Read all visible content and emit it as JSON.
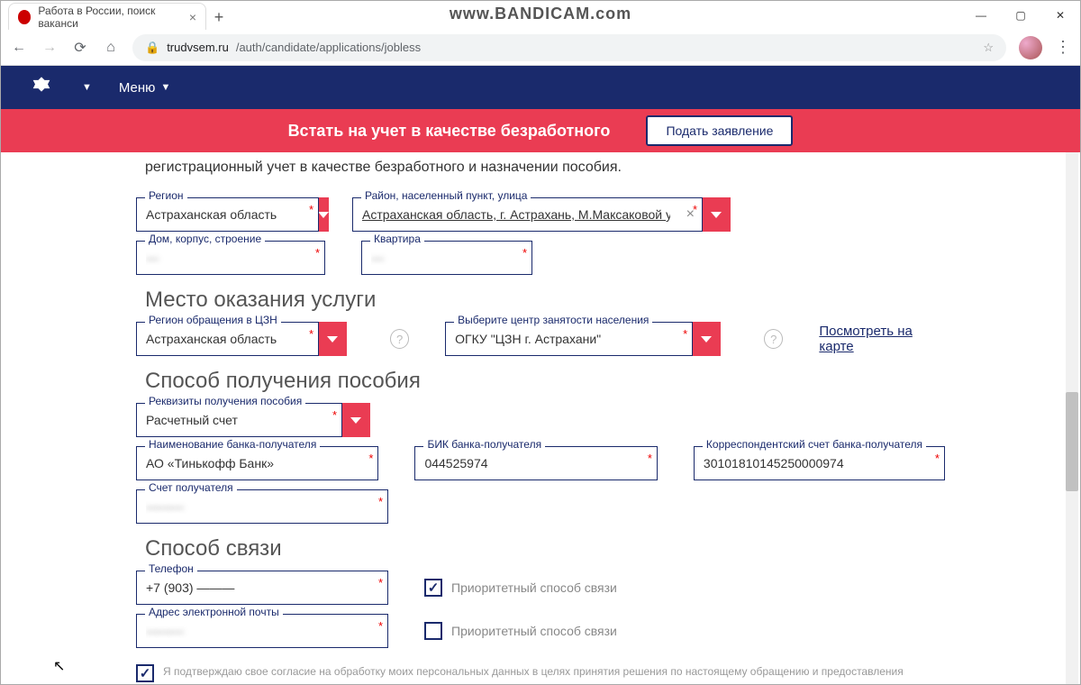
{
  "window": {
    "tab_title": "Работа в России, поиск ваканси",
    "watermark": "www.BANDICAM.com"
  },
  "browser": {
    "url_domain": "trudvsem.ru",
    "url_path": "/auth/candidate/applications/jobless"
  },
  "site_nav": {
    "menu": "Меню"
  },
  "banner": {
    "title": "Встать на учет в качестве безработного",
    "button": "Подать заявление"
  },
  "intro": "регистрационный учет в качестве безработного и назначении пособия.",
  "region": {
    "label": "Регион",
    "value": "Астраханская область"
  },
  "street": {
    "label": "Район, населенный пункт, улица",
    "value": "Астраханская область, г. Астрахань, М.Максаковой у..."
  },
  "house": {
    "label": "Дом, корпус, строение",
    "value": "—"
  },
  "flat": {
    "label": "Квартира",
    "value": "—"
  },
  "section_service": "Место оказания услуги",
  "czn_region": {
    "label": "Регион обращения в ЦЗН",
    "value": "Астраханская область"
  },
  "czn_center": {
    "label": "Выберите центр занятости населения",
    "value": "ОГКУ \"ЦЗН г. Астрахани\""
  },
  "map_link": "Посмотреть на карте",
  "section_benefit": "Способ получения пособия",
  "benefit_type": {
    "label": "Реквизиты получения пособия",
    "value": "Расчетный счет"
  },
  "bank_name": {
    "label": "Наименование банка-получателя",
    "value": "АО «Тинькофф Банк»"
  },
  "bik": {
    "label": "БИК банка-получателя",
    "value": "044525974"
  },
  "corr_acc": {
    "label": "Корреспондентский счет банка-получателя",
    "value": "30101810145250000974"
  },
  "acc": {
    "label": "Счет получателя",
    "value": "———"
  },
  "section_contact": "Способ связи",
  "phone": {
    "label": "Телефон",
    "value": "+7 (903) ———"
  },
  "email": {
    "label": "Адрес электронной почты",
    "value": "———"
  },
  "priority_label": "Приоритетный способ связи",
  "consent": "Я подтверждаю свое согласие на обработку моих персональных данных в целях принятия решения по настоящему обращению и предоставления"
}
